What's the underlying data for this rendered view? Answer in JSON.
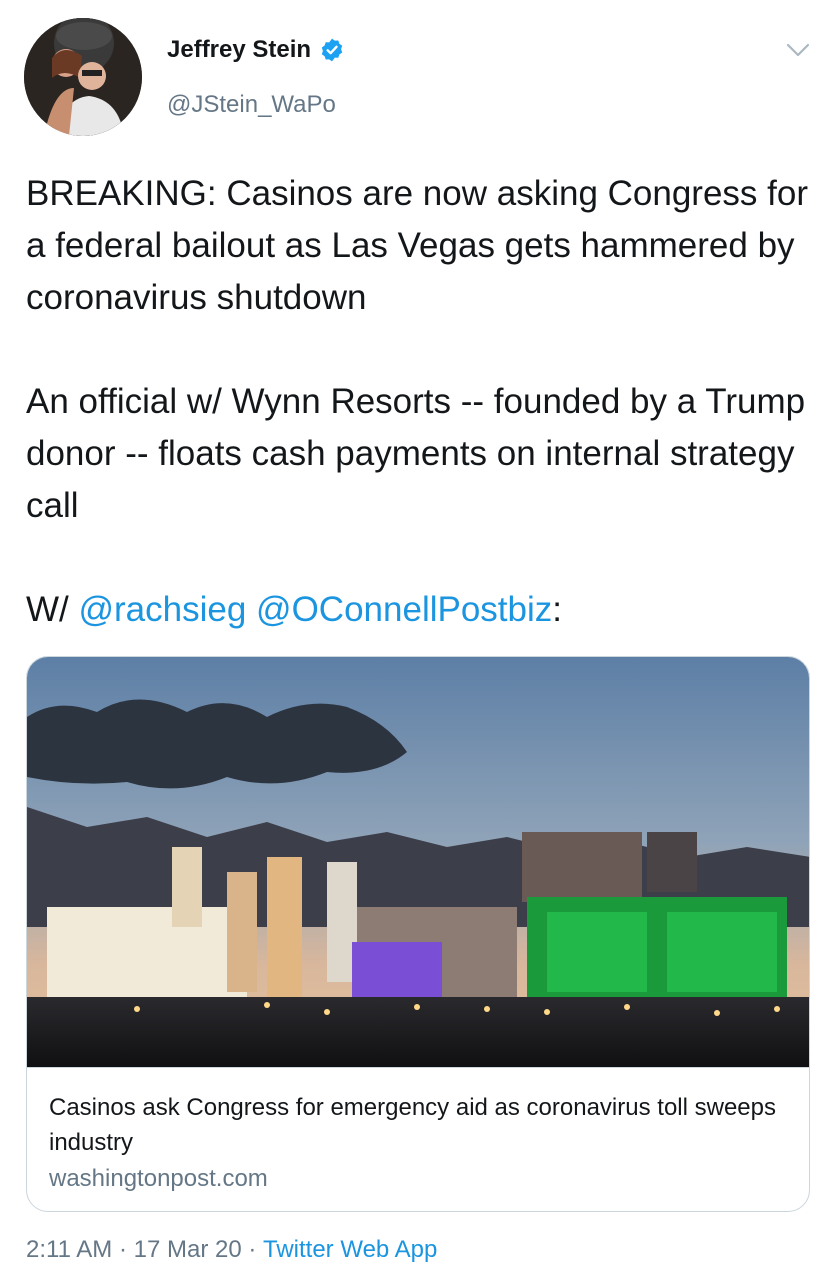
{
  "author": {
    "display_name": "Jeffrey Stein",
    "handle": "@JStein_WaPo",
    "verified": true
  },
  "tweet": {
    "paragraph1": "BREAKING: Casinos are now asking Congress for a federal bailout as Las Vegas gets hammered by coronavirus shutdown",
    "paragraph2": "An official w/ Wynn Resorts -- founded by a Trump donor -- floats cash payments on internal strategy call",
    "paragraph3_prefix": "W/ ",
    "mention1": "@rachsieg",
    "mention2": "@OConnellPostbiz",
    "paragraph3_suffix": ":"
  },
  "link_card": {
    "title": "Casinos ask Congress for emergency aid as coronavirus toll sweeps industry",
    "domain": "washingtonpost.com"
  },
  "meta": {
    "time": "2:11 AM",
    "separator": " · ",
    "date": "17 Mar 20",
    "source": "Twitter Web App"
  },
  "icons": {
    "verified": "verified-badge-icon",
    "caret": "chevron-down-icon"
  },
  "colors": {
    "link": "#1b95e0",
    "secondary_text": "#657786",
    "primary_text": "#14171a",
    "border": "#ccd6dd"
  }
}
